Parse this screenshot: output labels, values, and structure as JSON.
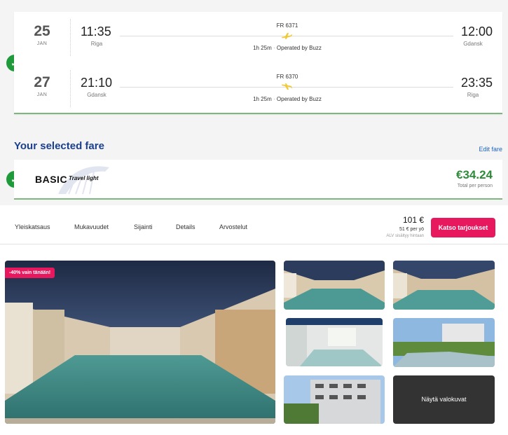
{
  "flights": [
    {
      "day": "25",
      "month": "JAN",
      "dep_time": "11:35",
      "dep_city": "Riga",
      "arr_time": "12:00",
      "arr_city": "Gdansk",
      "flight_no": "FR 6371",
      "duration": "1h 25m",
      "operator": "Operated by Buzz"
    },
    {
      "day": "27",
      "month": "JAN",
      "dep_time": "21:10",
      "dep_city": "Gdansk",
      "arr_time": "23:35",
      "arr_city": "Riga",
      "flight_no": "FR 6370",
      "duration": "1h 25m",
      "operator": "Operated by Buzz"
    }
  ],
  "fare": {
    "section_title": "Your selected fare",
    "edit_label": "Edit fare",
    "name": "BASIC",
    "subtitle": "Travel light",
    "price": "€34.24",
    "price_label": "Total per person"
  },
  "hotel_nav": {
    "tabs": [
      "Yleiskatsaus",
      "Mukavuudet",
      "Sijainti",
      "Details",
      "Arvostelut"
    ],
    "price": "101 €",
    "price_per_night": "51 € per yö",
    "vat_note": "ALV sisältyy hintaan",
    "offers_button": "Katso tarjoukset"
  },
  "gallery": {
    "badge": "-40% vain tänään!",
    "show_photos": "Näytä valokuvat"
  },
  "colors": {
    "check_green": "#1f9a3a",
    "title_blue": "#1a3f8f",
    "price_green": "#2e8b3a",
    "accent_pink": "#e8185f",
    "plane_yellow": "#f1c933"
  },
  "icons": {
    "check": "check-circle-icon",
    "plane": "airplane-icon"
  }
}
